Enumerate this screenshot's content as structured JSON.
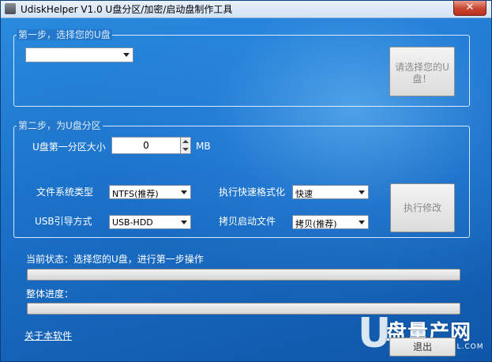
{
  "window": {
    "title": "UdiskHelper V1.0  U盘分区/加密/启动盘制作工具",
    "close_glyph": "✕"
  },
  "step1": {
    "legend": "第一步，选择您的U盘",
    "drive_select_value": "",
    "select_button": "请选择您的U盘！"
  },
  "step2": {
    "legend": "第二步，为U盘分区",
    "partition_size_label": "U盘第一分区大小",
    "partition_size_value": "0",
    "partition_size_unit": "MB",
    "fs_label": "文件系统类型",
    "fs_value": "NTFS(推荐)",
    "quick_format_label": "执行快速格式化",
    "quick_format_value": "快速",
    "usb_boot_label": "USB引导方式",
    "usb_boot_value": "USB-HDD",
    "copy_boot_label": "拷贝启动文件",
    "copy_boot_value": "拷贝(推荐)",
    "execute_button": "执行修改"
  },
  "status": {
    "current_text": "当前状态：选择您的U盘，进行第一步操作",
    "current_progress": 0,
    "overall_label": "整体进度：",
    "overall_progress": 0
  },
  "footer": {
    "about_link": "关于本软件",
    "exit_button": "退出"
  },
  "watermark": {
    "letter": "U",
    "text": "盘量产网",
    "url": "WWW.UPANTOOL.COM"
  },
  "colors": {
    "background": "#1b70c8",
    "progress_fill": "#37b44a"
  },
  "icons": [
    "app-icon",
    "close-icon",
    "dropdown-arrow-icon",
    "spin-up-icon",
    "spin-down-icon"
  ]
}
